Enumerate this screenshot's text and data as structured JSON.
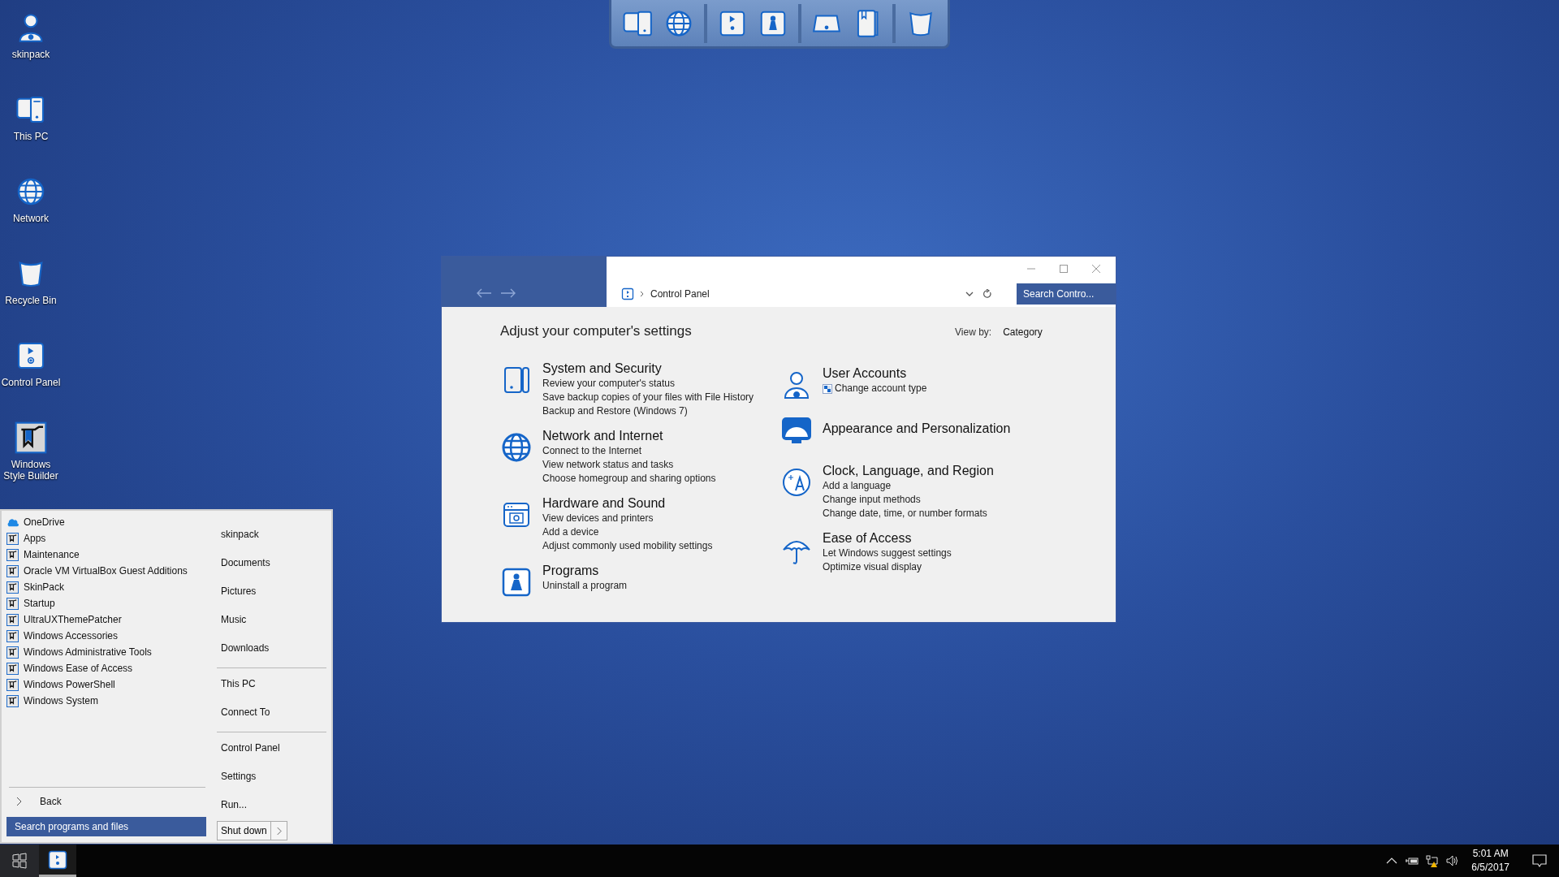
{
  "desktop_icons": [
    {
      "label": "skinpack"
    },
    {
      "label": "This PC"
    },
    {
      "label": "Network"
    },
    {
      "label": "Recycle Bin"
    },
    {
      "label": "Control Panel"
    },
    {
      "label": "Windows Style Builder"
    }
  ],
  "control_panel": {
    "address": "Control Panel",
    "search": {
      "placeholder": "Search Contro..."
    },
    "heading": "Adjust your computer's settings",
    "view_by": {
      "label": "View by:",
      "value": "Category"
    },
    "columns": [
      {
        "categories": [
          {
            "title": "System and Security",
            "links": [
              "Review your computer's status",
              "Save backup copies of your files with File History",
              "Backup and Restore (Windows 7)"
            ]
          },
          {
            "title": "Network and Internet",
            "links": [
              "Connect to the Internet",
              "View network status and tasks",
              "Choose homegroup and sharing options"
            ]
          },
          {
            "title": "Hardware and Sound",
            "links": [
              "View devices and printers",
              "Add a device",
              "Adjust commonly used mobility settings"
            ]
          },
          {
            "title": "Programs",
            "links": [
              "Uninstall a program"
            ]
          }
        ]
      },
      {
        "categories": [
          {
            "title": "User Accounts",
            "links": [
              "Change account type"
            ]
          },
          {
            "title": "Appearance and Personalization"
          },
          {
            "title": "Clock, Language, and Region",
            "links": [
              "Add a language",
              "Change input methods",
              "Change date, time, or number formats"
            ]
          },
          {
            "title": "Ease of Access",
            "links": [
              "Let Windows suggest settings",
              "Optimize visual display"
            ]
          }
        ]
      }
    ]
  },
  "start_menu": {
    "programs": [
      {
        "label": "OneDrive",
        "kind": "cloud"
      },
      {
        "label": "Apps",
        "kind": "folder"
      },
      {
        "label": "Maintenance",
        "kind": "folder"
      },
      {
        "label": "Oracle VM VirtualBox Guest Additions",
        "kind": "folder"
      },
      {
        "label": "SkinPack",
        "kind": "folder"
      },
      {
        "label": "Startup",
        "kind": "folder"
      },
      {
        "label": "UltraUXThemePatcher",
        "kind": "folder"
      },
      {
        "label": "Windows Accessories",
        "kind": "folder"
      },
      {
        "label": "Windows Administrative Tools",
        "kind": "folder"
      },
      {
        "label": "Windows Ease of Access",
        "kind": "folder"
      },
      {
        "label": "Windows PowerShell",
        "kind": "folder"
      },
      {
        "label": "Windows System",
        "kind": "folder"
      }
    ],
    "places": [
      {
        "items": [
          "skinpack",
          "Documents",
          "Pictures",
          "Music",
          "Downloads"
        ]
      },
      {
        "items": [
          "This PC",
          "Connect To"
        ]
      },
      {
        "items": [
          "Control Panel",
          "Settings",
          "Run..."
        ]
      }
    ],
    "back": "Back",
    "search": {
      "placeholder": "Search programs and files"
    },
    "shutdown": "Shut down"
  },
  "taskbar": {
    "time": "5:01 AM",
    "date": "6/5/2017"
  }
}
